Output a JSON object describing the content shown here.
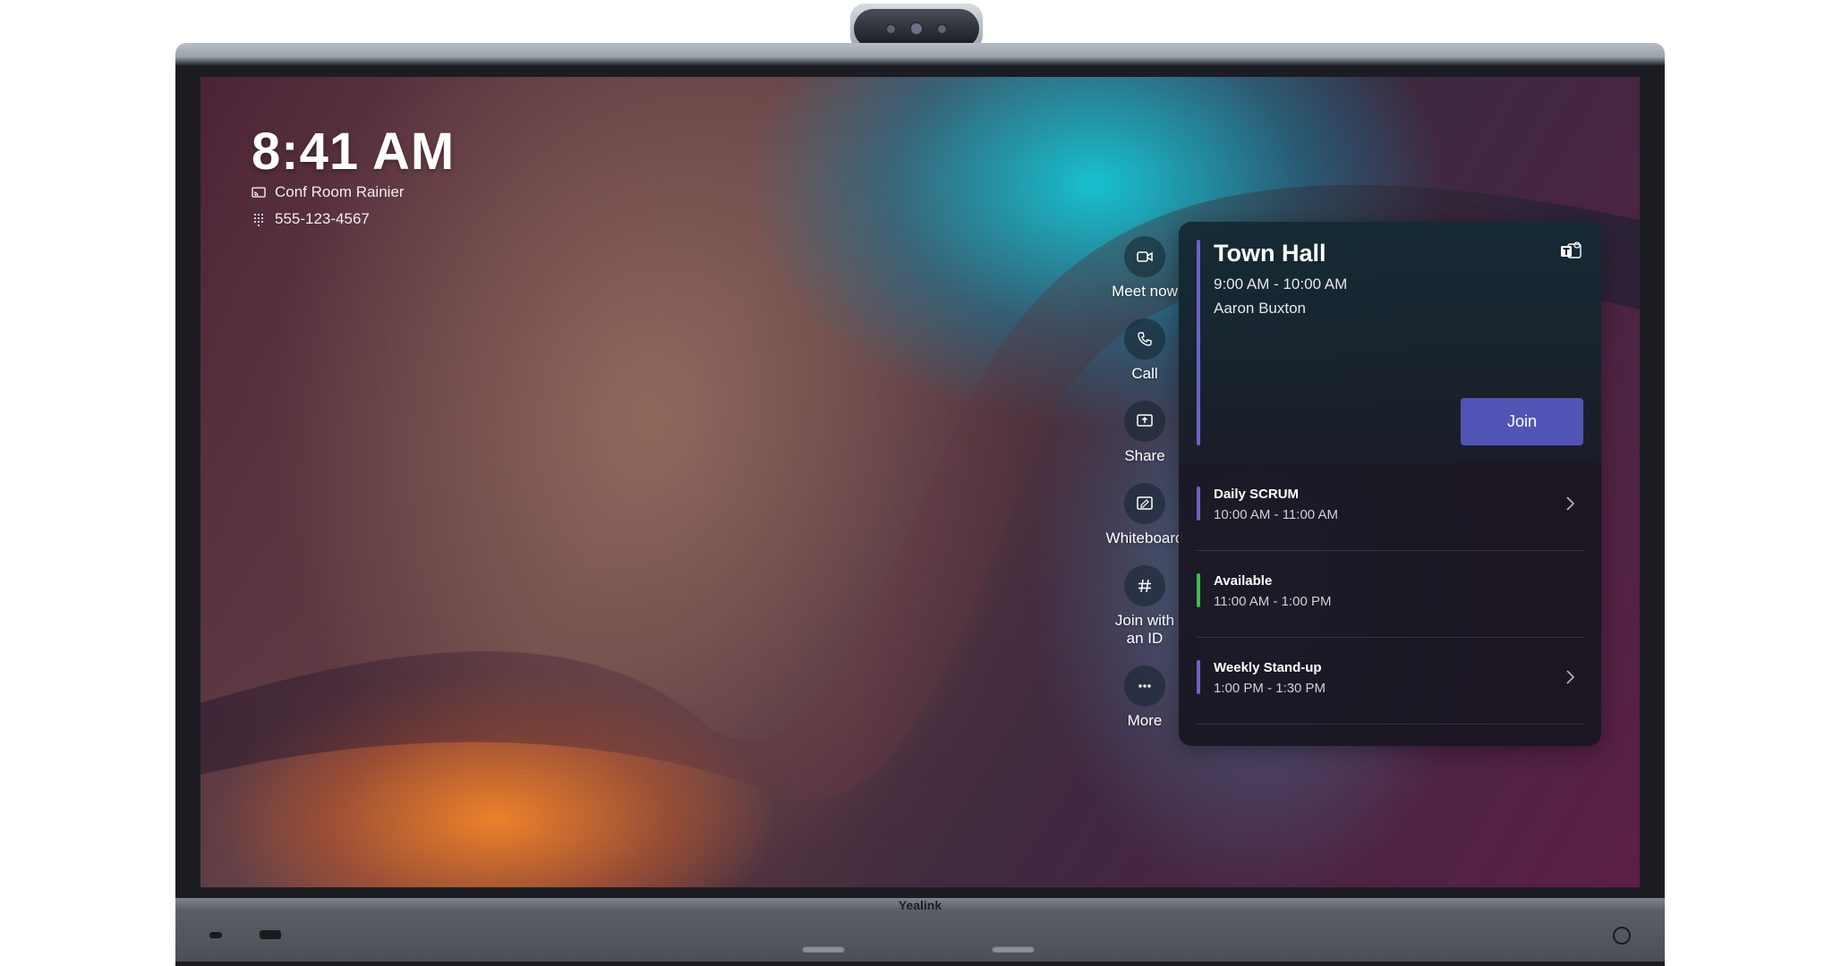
{
  "device": {
    "brand": "Yealink"
  },
  "home": {
    "time": "8:41 AM",
    "room_name": "Conf Room Rainier",
    "phone_number": "555-123-4567"
  },
  "actions": [
    {
      "label": "Meet now",
      "icon": "video-camera-icon"
    },
    {
      "label": "Call",
      "icon": "phone-icon"
    },
    {
      "label": "Share",
      "icon": "share-screen-icon"
    },
    {
      "label": "Whiteboard",
      "icon": "whiteboard-icon"
    },
    {
      "label": "Join with an ID",
      "icon": "hash-icon"
    },
    {
      "label": "More",
      "icon": "more-dots-icon"
    }
  ],
  "featured_meeting": {
    "title": "Town Hall",
    "time": "9:00 AM - 10:00 AM",
    "organizer": "Aaron Buxton",
    "join_label": "Join",
    "accent_color": "#6b63c9",
    "app_icon": "teams-icon"
  },
  "agenda": [
    {
      "name": "Daily SCRUM",
      "time": "10:00 AM - 11:00 AM",
      "color": "#6b63c9",
      "has_chevron": true
    },
    {
      "name": "Available",
      "time": "11:00 AM - 1:00 PM",
      "color": "#3dbb4f",
      "has_chevron": false
    },
    {
      "name": "Weekly Stand-up",
      "time": "1:00 PM - 1:30 PM",
      "color": "#6b63c9",
      "has_chevron": true
    }
  ],
  "colors": {
    "join_button": "#5254b5",
    "panel_bg": "#18161f"
  }
}
